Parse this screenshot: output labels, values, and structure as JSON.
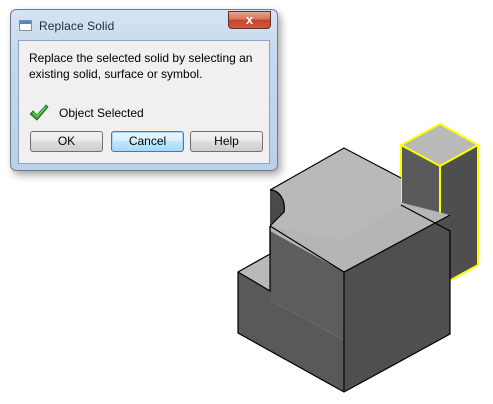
{
  "dialog": {
    "title": "Replace Solid",
    "close_label": "x",
    "message": "Replace the selected solid by selecting an existing solid, surface or symbol.",
    "status_text": "Object Selected",
    "buttons": {
      "ok": "OK",
      "cancel": "Cancel",
      "help": "Help"
    }
  },
  "icons": {
    "app": "window-icon",
    "status": "green-checkmark-icon",
    "close": "close-icon"
  },
  "colors": {
    "solid_top": "#b9b9b9",
    "solid_side": "#5a5a5a",
    "selection_highlight": "#ffff00",
    "checkmark": "#2e9b2e"
  }
}
